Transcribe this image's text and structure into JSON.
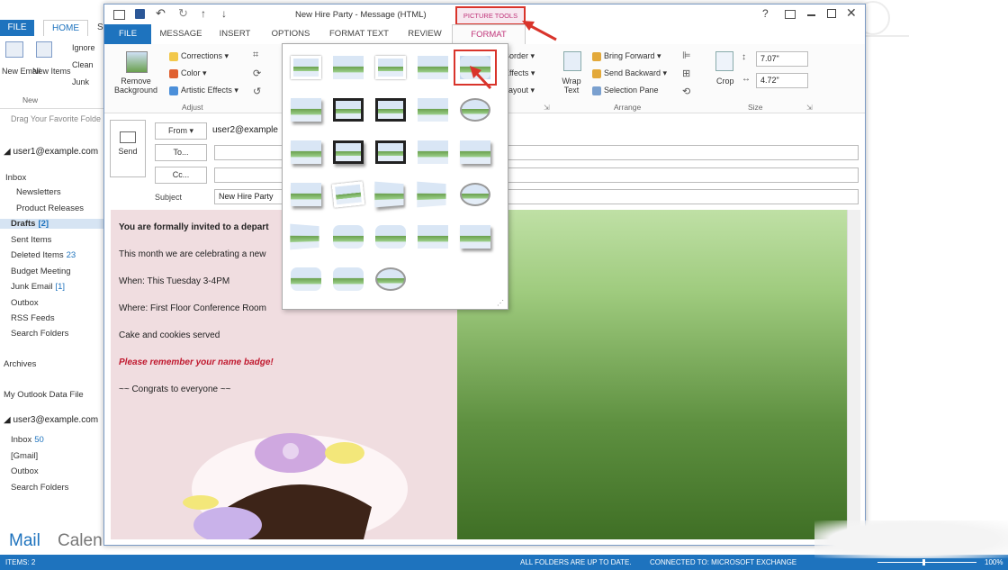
{
  "outlook": {
    "tabs": {
      "file": "FILE",
      "home": "HOME",
      "send_recv": "S"
    },
    "ribbon": {
      "new_email": "New Email",
      "new_items": "New Items",
      "ignore": "Ignore",
      "clean_up": "Clean",
      "junk": "Junk",
      "group_new": "New"
    },
    "favorites_hint": "Drag Your Favorite Folde",
    "account1": "user1@example.com",
    "folders1": [
      {
        "label": "Inbox",
        "count": ""
      },
      {
        "label": "Newsletters",
        "count": ""
      },
      {
        "label": "Product Releases",
        "count": ""
      },
      {
        "label": "Drafts",
        "count": "[2]"
      },
      {
        "label": "Sent Items",
        "count": ""
      },
      {
        "label": "Deleted Items",
        "count": "23"
      },
      {
        "label": "Budget Meeting",
        "count": ""
      },
      {
        "label": "Junk Email",
        "count": "[1]"
      },
      {
        "label": "Outbox",
        "count": ""
      },
      {
        "label": "RSS Feeds",
        "count": ""
      },
      {
        "label": "Search Folders",
        "count": ""
      },
      {
        "label": "Archives",
        "count": ""
      },
      {
        "label": "My Outlook Data File",
        "count": ""
      }
    ],
    "account2": "user3@example.com",
    "folders2": [
      {
        "label": "Inbox",
        "count": "50"
      },
      {
        "label": "[Gmail]",
        "count": ""
      },
      {
        "label": "Outbox",
        "count": ""
      },
      {
        "label": "Search Folders",
        "count": ""
      }
    ],
    "nav": {
      "mail": "Mail",
      "calendar": "Calen"
    },
    "status": {
      "items": "ITEMS: 2",
      "sync": "ALL FOLDERS ARE UP TO DATE.",
      "connection": "CONNECTED TO: MICROSOFT EXCHANGE",
      "zoom": "100%"
    }
  },
  "message": {
    "title": "New Hire Party - Message (HTML)",
    "context_tab": "PICTURE TOOLS",
    "help": "?",
    "tabs": [
      "FILE",
      "MESSAGE",
      "INSERT",
      "OPTIONS",
      "FORMAT TEXT",
      "REVIEW",
      "FORMAT"
    ],
    "ribbon": {
      "remove_bg": "Remove Background",
      "corrections": "Corrections",
      "color": "Color",
      "artistic": "Artistic Effects",
      "group_adjust": "Adjust",
      "picture_border": "Border",
      "picture_effects": "Effects",
      "picture_layout": "Layout",
      "wrap_text": "Wrap Text",
      "bring_forward": "Bring Forward",
      "send_backward": "Send Backward",
      "selection_pane": "Selection Pane",
      "group_arrange": "Arrange",
      "crop": "Crop",
      "height": "7.07\"",
      "width": "4.72\"",
      "group_size": "Size"
    },
    "header": {
      "send": "Send",
      "from": "From",
      "from_value": "user2@example",
      "to": "To...",
      "cc": "Cc...",
      "subject_label": "Subject",
      "subject_value": "New Hire Party"
    },
    "body": [
      "You are formally invited to a depart",
      "This month we are celebrating a new",
      "When: This Tuesday 3-4PM",
      "Where:  First Floor Conference Room",
      "Cake and cookies served",
      "Please remember your name badge!",
      "~~ Congrats to everyone  ~~"
    ]
  },
  "gallery": {
    "selected_index": 4,
    "styles": [
      "simple-frame-white",
      "soft-edge",
      "simple-frame-gray",
      "plain",
      "soft-edge-rounded",
      "drop-shadow",
      "thick-black-frame",
      "metal-frame",
      "soft-rectangle",
      "oval-reflected",
      "beveled-matte",
      "black-shadow",
      "compound-frame",
      "moderate-frame",
      "reflected-bevel",
      "center-shadow",
      "rotated-white",
      "perspective-shadow",
      "relaxed-perspective",
      "soft-edge-oval",
      "bevel-perspective",
      "reflected-rounded",
      "metal-rounded",
      "snip-diagonal",
      "bevel-rect",
      "rounded-diagonal",
      "rounded-rectangle",
      "metal-oval"
    ]
  }
}
